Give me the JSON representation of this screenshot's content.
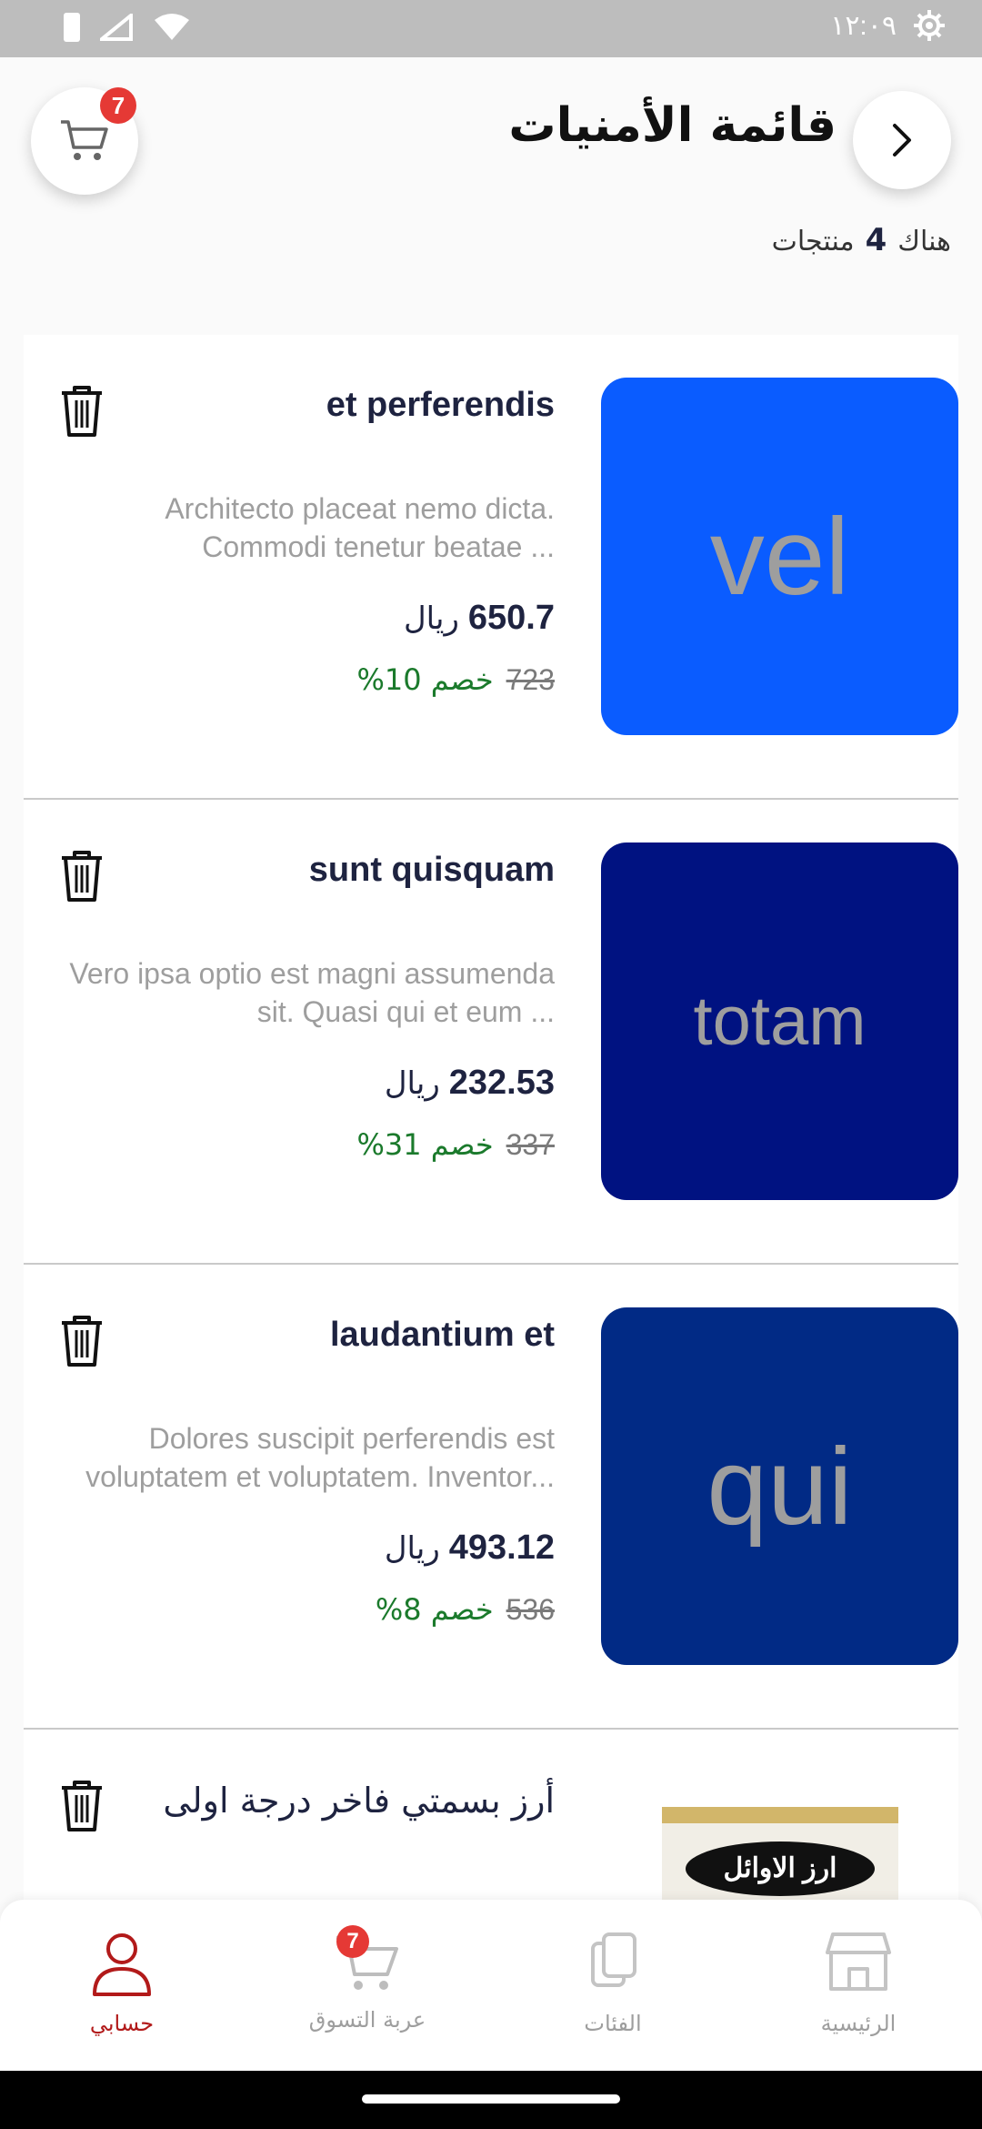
{
  "status_bar": {
    "time": "١٢:٠٩"
  },
  "header": {
    "title": "قائمة الأمنيات",
    "cart_badge": "7",
    "count_prefix": "هناك",
    "count_value": "4",
    "count_suffix": "منتجات"
  },
  "items": [
    {
      "title": "et perferendis",
      "desc": "Architecto placeat nemo dicta. Commodi tenetur beatae ...",
      "price": "650.7",
      "currency": "ريال",
      "old_price": "723",
      "discount": "خصم 10%",
      "thumb_text": "vel",
      "thumb_color": "#0a5cff"
    },
    {
      "title": "sunt quisquam",
      "desc": "Vero ipsa optio est magni assumenda sit. Quasi qui et eum ...",
      "price": "232.53",
      "currency": "ريال",
      "old_price": "337",
      "discount": "خصم 31%",
      "thumb_text": "totam",
      "thumb_color": "#001281"
    },
    {
      "title": "laudantium et",
      "desc": "Dolores suscipit perferendis est voluptatem et voluptatem. Inventor...",
      "price": "493.12",
      "currency": "ريال",
      "old_price": "536",
      "discount": "خصم 8%",
      "thumb_text": "qui",
      "thumb_color": "#012a85"
    },
    {
      "title": "أرز بسمتي فاخر درجة اولى",
      "rice_label": "ارز الاوائل"
    }
  ],
  "bottom_nav": {
    "account": "حسابي",
    "cart": "عربة التسوق",
    "cart_badge": "7",
    "categories": "الفئات",
    "home": "الرئيسية"
  }
}
